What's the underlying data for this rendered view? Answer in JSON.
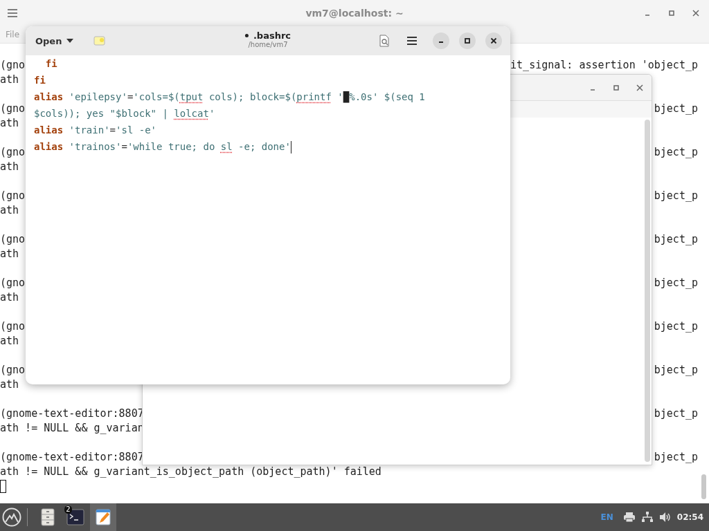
{
  "terminal": {
    "title": "vm7@localhost: ~",
    "menu": [
      "File"
    ],
    "lines": [
      {
        "kind": "text",
        "left": "(gno",
        "right": "it_signal: assertion 'object_p"
      },
      {
        "kind": "text",
        "left": "ath"
      },
      {
        "kind": "blank"
      },
      {
        "kind": "text",
        "left": "(gno",
        "right": "bject_p"
      },
      {
        "kind": "text",
        "left": "ath"
      },
      {
        "kind": "blank"
      },
      {
        "kind": "text",
        "left": "(gno",
        "right": "bject_p"
      },
      {
        "kind": "text",
        "left": "ath"
      },
      {
        "kind": "blank"
      },
      {
        "kind": "text",
        "left": "(gno",
        "right": "bject_p"
      },
      {
        "kind": "text",
        "left": "ath"
      },
      {
        "kind": "blank"
      },
      {
        "kind": "text",
        "left": "(gno",
        "right": "bject_p"
      },
      {
        "kind": "text",
        "left": "ath"
      },
      {
        "kind": "blank"
      },
      {
        "kind": "text",
        "left": "(gno",
        "right": "bject_p"
      },
      {
        "kind": "text",
        "left": "ath"
      },
      {
        "kind": "blank"
      },
      {
        "kind": "text",
        "left": "(gno",
        "right": "bject_p"
      },
      {
        "kind": "text",
        "left": "ath"
      },
      {
        "kind": "blank"
      },
      {
        "kind": "text",
        "left": "(gno",
        "right": "bject_p"
      },
      {
        "kind": "text",
        "left": "ath"
      },
      {
        "kind": "blank"
      },
      {
        "kind": "text",
        "left": "(gnome-text-editor:8807",
        "right": "bject_p"
      },
      {
        "kind": "text",
        "left": "ath != NULL && g_varian"
      },
      {
        "kind": "blank"
      },
      {
        "kind": "text",
        "left": "(gnome-text-editor:8807",
        "right": "bject_p"
      },
      {
        "kind": "text",
        "left": "ath != NULL && g_variant_is_object_path (object_path)' failed"
      },
      {
        "kind": "cursor"
      }
    ]
  },
  "editor": {
    "open_label": "Open",
    "title": ".bashrc",
    "modified": true,
    "subtitle": "/home/vm7",
    "lines": [
      [
        {
          "kind": "keyword",
          "text": "  fi",
          "misspelled": false
        }
      ],
      [
        {
          "kind": "keyword",
          "text": "fi",
          "misspelled": false
        }
      ],
      [
        {
          "kind": "keyword",
          "text": "alias",
          "misspelled": false
        },
        {
          "kind": "string",
          "text": " 'epilepsy'",
          "misspelled": false
        },
        {
          "kind": "plain",
          "text": "=",
          "misspelled": false
        },
        {
          "kind": "string",
          "text": "'cols=$(",
          "misspelled": false
        },
        {
          "kind": "string",
          "text": "tput",
          "misspelled": true
        },
        {
          "kind": "string",
          "text": " cols); block=$(",
          "misspelled": false
        },
        {
          "kind": "string",
          "text": "printf",
          "misspelled": true
        },
        {
          "kind": "string",
          "text": " '",
          "misspelled": false
        },
        {
          "kind": "block",
          "text": "█"
        },
        {
          "kind": "string",
          "text": "%.0s' $(seq 1",
          "misspelled": false
        }
      ],
      [
        {
          "kind": "string",
          "text": "$cols)); yes \"$block\" | ",
          "misspelled": false
        },
        {
          "kind": "string",
          "text": "lolcat",
          "misspelled": true
        },
        {
          "kind": "string",
          "text": "'",
          "misspelled": false
        }
      ],
      [
        {
          "kind": "keyword",
          "text": "alias",
          "misspelled": false
        },
        {
          "kind": "string",
          "text": " 'train'",
          "misspelled": false
        },
        {
          "kind": "plain",
          "text": "=",
          "misspelled": false
        },
        {
          "kind": "string",
          "text": "'sl -e'",
          "misspelled": false
        }
      ],
      [
        {
          "kind": "keyword",
          "text": "alias",
          "misspelled": false
        },
        {
          "kind": "string",
          "text": " 'trainos'",
          "misspelled": false
        },
        {
          "kind": "plain",
          "text": "=",
          "misspelled": false
        },
        {
          "kind": "string",
          "text": "'while true; do ",
          "misspelled": false
        },
        {
          "kind": "string",
          "text": "sl",
          "misspelled": true
        },
        {
          "kind": "string",
          "text": " -e; done'",
          "misspelled": false
        }
      ]
    ]
  },
  "taskbar": {
    "apps": [
      {
        "kind": "files",
        "selected": false
      },
      {
        "kind": "terminal",
        "selected": false,
        "badge": "2"
      },
      {
        "kind": "editor",
        "selected": true
      }
    ],
    "language": "EN",
    "clock": "02:54"
  }
}
